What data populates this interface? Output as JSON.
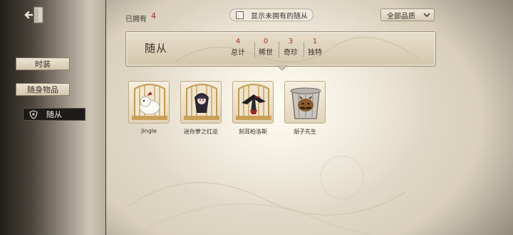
{
  "sidebar": {
    "items": [
      {
        "label": "时装",
        "active": false
      },
      {
        "label": "随身物品",
        "active": false
      },
      {
        "label": "随从",
        "active": true
      }
    ]
  },
  "topbar": {
    "owned_label": "已拥有",
    "owned_count": "4",
    "toggle_label": "显示未拥有的随从",
    "toggle_checked": false,
    "filter_value": "全部品质"
  },
  "banner": {
    "title": "随从",
    "stats": [
      {
        "value": "4",
        "label": "总计"
      },
      {
        "value": "0",
        "label": "稀世"
      },
      {
        "value": "3",
        "label": "奇珍"
      },
      {
        "value": "1",
        "label": "独特"
      }
    ]
  },
  "pets": [
    {
      "name": "Jingle",
      "icon": "white-creature-cage-icon",
      "frame": "golden-cage"
    },
    {
      "name": "迷你萝之红巫",
      "icon": "dark-witch-cage-icon",
      "frame": "golden-cage"
    },
    {
      "name": "刻耳柏洛斯",
      "icon": "crow-plague-cage-icon",
      "frame": "golden-cage"
    },
    {
      "name": "胡子先生",
      "icon": "mustache-trashcan-icon",
      "frame": "trash-can"
    }
  ],
  "colors": {
    "accent_number": "#a03826",
    "active_tab_bg": "#1d1b19",
    "paper": "#e6ddca"
  }
}
